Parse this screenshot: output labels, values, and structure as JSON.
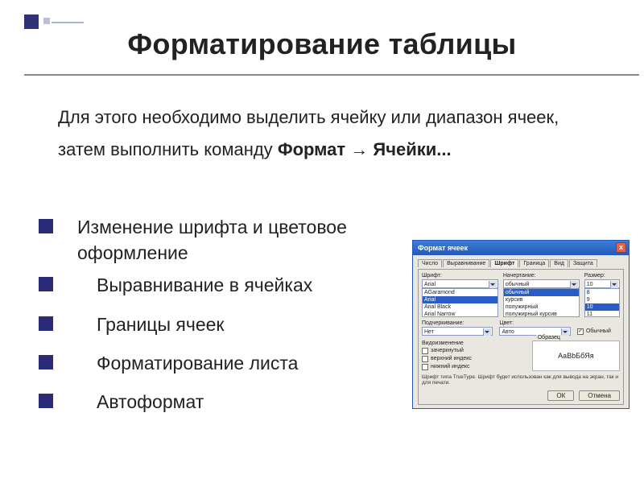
{
  "title": "Форматирование таблицы",
  "intro": {
    "part1": "Для этого необходимо выделить ячейку или диапазон ячеек, затем выполнить команду ",
    "bold": "Формат → Ячейки..."
  },
  "bullets": [
    "Изменение шрифта и цветовое оформление",
    "Выравнивание в ячейках",
    "Границы ячеек",
    "Форматирование листа",
    "Автоформат"
  ],
  "dialog": {
    "title": "Формат ячеек",
    "close": "x",
    "tabs": [
      "Число",
      "Выравнивание",
      "Шрифт",
      "Граница",
      "Вид",
      "Защита"
    ],
    "active_tab": "Шрифт",
    "font": {
      "label": "Шрифт:",
      "value": "Arial",
      "options": [
        "AGaramond",
        "Arial",
        "Arial Black",
        "Arial Narrow"
      ]
    },
    "style": {
      "label": "Начертание:",
      "value": "обычный",
      "options": [
        "обычный",
        "курсив",
        "полужирный",
        "полужирный курсив"
      ]
    },
    "size": {
      "label": "Размер:",
      "value": "10",
      "options": [
        "8",
        "9",
        "10",
        "11"
      ]
    },
    "underline": {
      "label": "Подчеркивание:",
      "value": "Нет"
    },
    "color": {
      "label": "Цвет:",
      "value": "Авто"
    },
    "default_font": {
      "label": "Обычный",
      "checked": true
    },
    "effects": {
      "label": "Видоизменение",
      "items": [
        {
          "label": "зачеркнутый",
          "checked": false
        },
        {
          "label": "верхний индекс",
          "checked": false
        },
        {
          "label": "нижний индекс",
          "checked": false
        }
      ]
    },
    "preview": {
      "label": "Образец",
      "text": "АаBbБбЯя"
    },
    "hint": "Шрифт типа TrueType. Шрифт будет использован как для вывода на экран, так и для печати.",
    "buttons": {
      "ok": "ОК",
      "cancel": "Отмена"
    }
  }
}
